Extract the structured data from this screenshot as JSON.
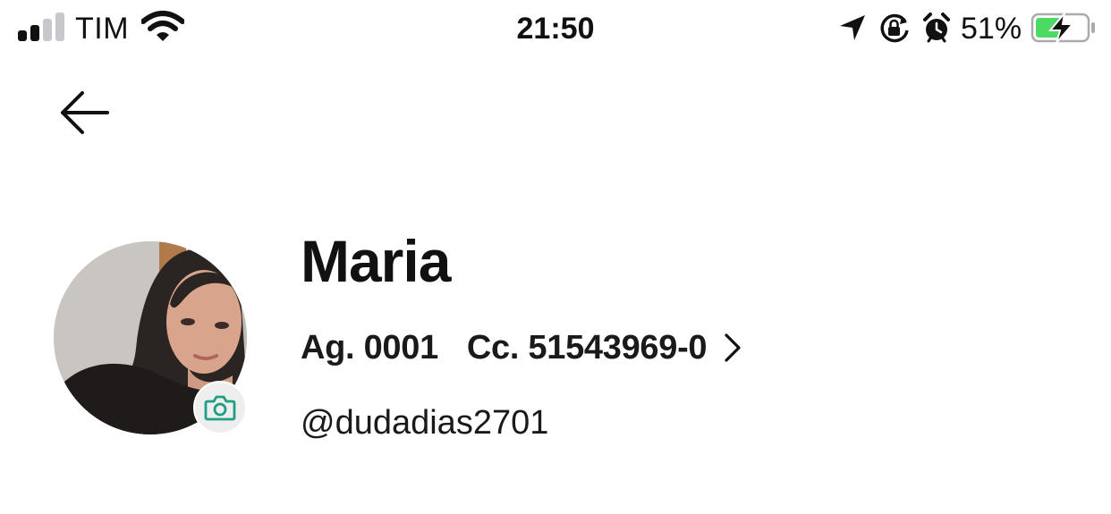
{
  "status_bar": {
    "carrier": "TIM",
    "time": "21:50",
    "battery_percent": "51%",
    "battery_level": 0.51,
    "battery_charging": true,
    "signal_bars_active": 2,
    "signal_bars_total": 4,
    "icons": [
      "signal-icon",
      "wifi-icon",
      "location-arrow-icon",
      "rotation-lock-icon",
      "alarm-icon",
      "battery-icon",
      "charging-bolt-icon"
    ]
  },
  "nav": {
    "back_icon": "arrow-left-icon"
  },
  "profile": {
    "name": "Maria",
    "agency": "Ag. 0001",
    "account": "Cc. 51543969-0",
    "username": "@dudadias2701",
    "camera_icon": "camera-icon",
    "chevron_icon": "chevron-right-icon"
  },
  "colors": {
    "text": "#111111",
    "battery_fill": "#4cd964",
    "camera_accent": "#1f9e86",
    "camera_bg": "#eeeeee",
    "signal_inactive": "#c7c7cc"
  }
}
